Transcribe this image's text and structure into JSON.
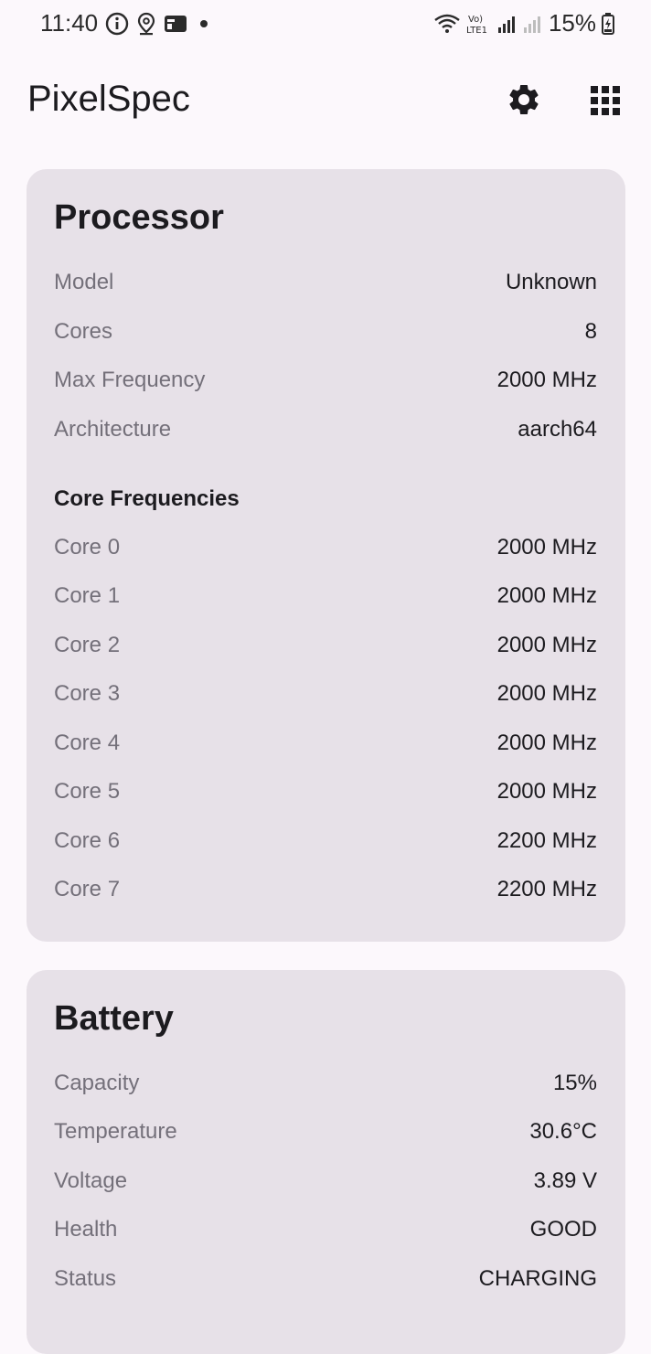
{
  "status_bar": {
    "time": "11:40",
    "battery_percent": "15%",
    "volte_label": "Vo) LTE1"
  },
  "app_bar": {
    "title": "PixelSpec"
  },
  "processor": {
    "title": "Processor",
    "rows": [
      {
        "label": "Model",
        "value": "Unknown"
      },
      {
        "label": "Cores",
        "value": "8"
      },
      {
        "label": "Max Frequency",
        "value": "2000 MHz"
      },
      {
        "label": "Architecture",
        "value": "aarch64"
      }
    ],
    "core_heading": "Core Frequencies",
    "cores": [
      {
        "label": "Core 0",
        "value": "2000 MHz"
      },
      {
        "label": "Core 1",
        "value": "2000 MHz"
      },
      {
        "label": "Core 2",
        "value": "2000 MHz"
      },
      {
        "label": "Core 3",
        "value": "2000 MHz"
      },
      {
        "label": "Core 4",
        "value": "2000 MHz"
      },
      {
        "label": "Core 5",
        "value": "2000 MHz"
      },
      {
        "label": "Core 6",
        "value": "2200 MHz"
      },
      {
        "label": "Core 7",
        "value": "2200 MHz"
      }
    ]
  },
  "battery": {
    "title": "Battery",
    "rows": [
      {
        "label": "Capacity",
        "value": "15%"
      },
      {
        "label": "Temperature",
        "value": "30.6°C"
      },
      {
        "label": "Voltage",
        "value": "3.89 V"
      },
      {
        "label": "Health",
        "value": "GOOD"
      },
      {
        "label": "Status",
        "value": "CHARGING"
      }
    ]
  }
}
